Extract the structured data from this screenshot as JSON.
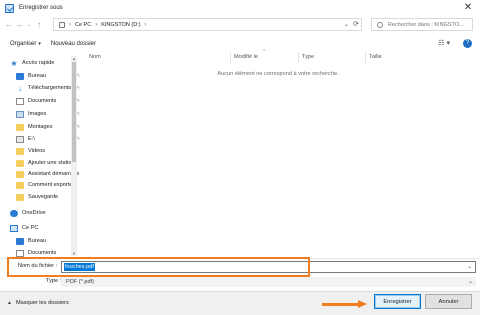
{
  "window": {
    "title": "Enregistrer sous"
  },
  "nav": {
    "breadcrumb": [
      "Ce PC",
      "KINGSTON (D:)"
    ],
    "search_placeholder": "Rechercher dans : KINGSTO..."
  },
  "toolbar": {
    "organize": "Organiser",
    "new_folder": "Nouveau dossier"
  },
  "sidebar": {
    "items": [
      {
        "label": "Accès rapide",
        "icon": "star-icon",
        "pinned": false
      },
      {
        "label": "Bureau",
        "icon": "desktop-icon",
        "pinned": true
      },
      {
        "label": "Téléchargements",
        "icon": "download-icon",
        "pinned": true
      },
      {
        "label": "Documents",
        "icon": "document-icon",
        "pinned": true
      },
      {
        "label": "Images",
        "icon": "image-icon",
        "pinned": true
      },
      {
        "label": "Montages",
        "icon": "folder-icon",
        "pinned": true
      },
      {
        "label": "E:\\",
        "icon": "drive-icon",
        "pinned": true
      },
      {
        "label": "Videos",
        "icon": "folder-icon",
        "pinned": false
      },
      {
        "label": "Ajouter une station",
        "icon": "folder-icon",
        "pinned": false
      },
      {
        "label": "Assistant démarrage",
        "icon": "folder-icon",
        "pinned": false
      },
      {
        "label": "Comment exporter",
        "icon": "folder-icon",
        "pinned": false
      },
      {
        "label": "Sauvegarde",
        "icon": "folder-icon",
        "pinned": false
      },
      {
        "label": "OneDrive",
        "icon": "cloud-icon",
        "pinned": false
      },
      {
        "label": "Ce PC",
        "icon": "pc-icon",
        "pinned": false
      },
      {
        "label": "Bureau",
        "icon": "desktop-icon",
        "pinned": false
      },
      {
        "label": "Documents",
        "icon": "document-icon",
        "pinned": false
      }
    ]
  },
  "columns": {
    "name": "Nom",
    "modified": "Modifié le",
    "type": "Type",
    "size": "Taille"
  },
  "empty_message": "Aucun élément ne correspond à votre recherche.",
  "file": {
    "name_label": "Nom du fichier :",
    "name_value": "fouches.pdf",
    "type_label": "Type :",
    "type_value": "PDF (*.pdf)"
  },
  "footer": {
    "hide_folders": "Masquer les dossiers",
    "save": "Enregistrer",
    "cancel": "Annuler"
  },
  "colors": {
    "highlight": "#f07d1f",
    "accent": "#0078d7"
  }
}
